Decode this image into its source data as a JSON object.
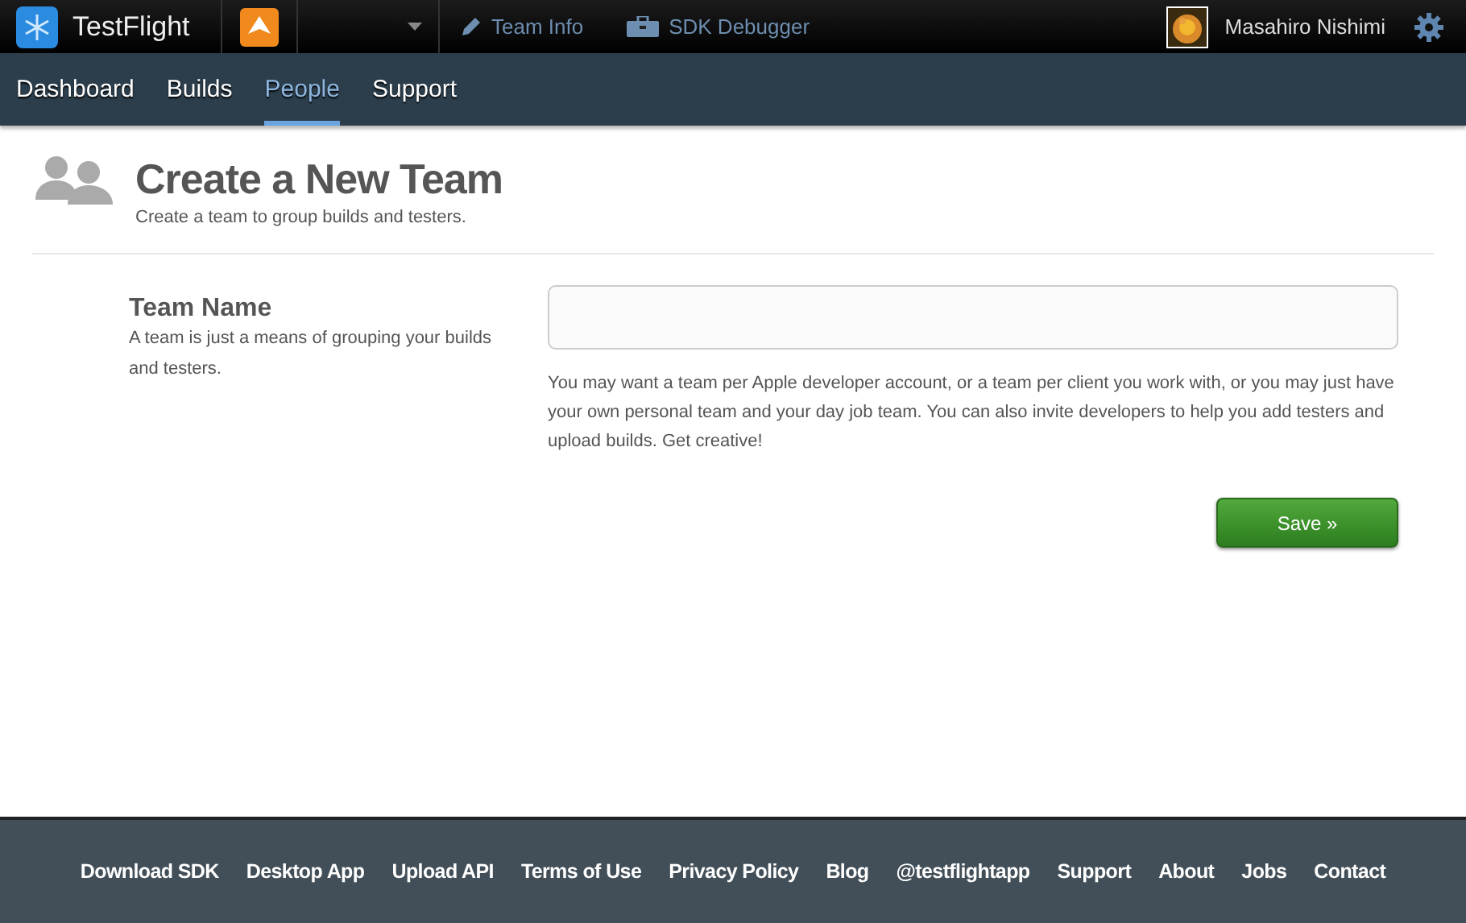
{
  "topbar": {
    "brand": "TestFlight",
    "links": [
      {
        "kind": "edit",
        "label": "Team Info"
      },
      {
        "kind": "kit",
        "label": "SDK Debugger"
      }
    ],
    "user": {
      "name": "Masahiro Nishimi"
    }
  },
  "nav": [
    {
      "label": "Dashboard",
      "selected": false
    },
    {
      "label": "Builds",
      "selected": false
    },
    {
      "label": "People",
      "selected": true
    },
    {
      "label": "Support",
      "selected": false
    }
  ],
  "header": {
    "title": "Create a New Team",
    "subtitle": "Create a team to group builds and testers."
  },
  "form": {
    "label": "Team Name",
    "description": "A team is just a means of grouping your builds and testers.",
    "help": "You may want a team per Apple developer account, or a team per client you work with, or you may just have your own personal team and your day job team. You can also invite developers to help you add testers and upload builds. Get creative!",
    "submit": "Save »"
  },
  "footer": [
    "Download SDK",
    "Desktop App",
    "Upload API",
    "Terms of Use",
    "Privacy Policy",
    "Blog",
    "@testflightapp",
    "Support",
    "About",
    "Jobs",
    "Contact"
  ]
}
